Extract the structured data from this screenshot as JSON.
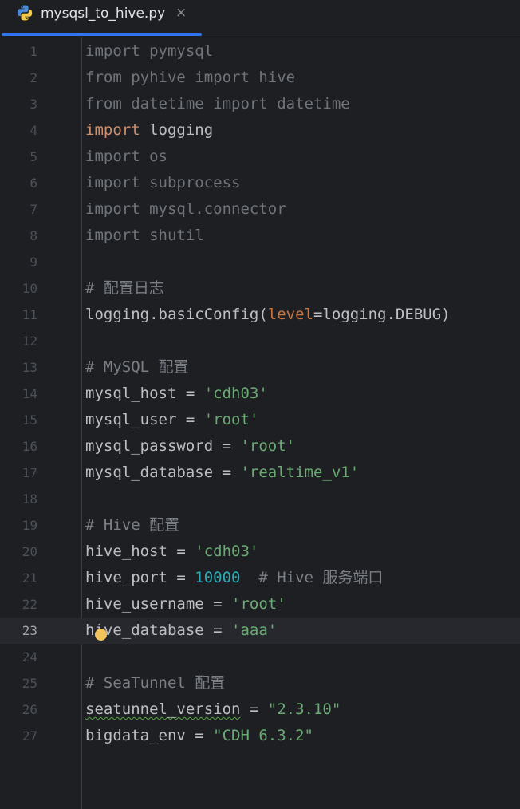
{
  "tab": {
    "title": "mysqsl_to_hive.py",
    "close_glyph": "×",
    "icon": "python-icon"
  },
  "editor": {
    "current_line": 23,
    "intention_icon": "lightbulb-icon",
    "lines": [
      {
        "n": "1",
        "tokens": [
          {
            "t": "import pymysql",
            "c": "dim"
          }
        ]
      },
      {
        "n": "2",
        "tokens": [
          {
            "t": "from pyhive import hive",
            "c": "dim"
          }
        ]
      },
      {
        "n": "3",
        "tokens": [
          {
            "t": "from datetime import datetime",
            "c": "dim"
          }
        ]
      },
      {
        "n": "4",
        "tokens": [
          {
            "t": "import",
            "c": "kw"
          },
          {
            "t": " logging",
            "c": "plain"
          }
        ]
      },
      {
        "n": "5",
        "tokens": [
          {
            "t": "import os",
            "c": "dim"
          }
        ]
      },
      {
        "n": "6",
        "tokens": [
          {
            "t": "import subprocess",
            "c": "dim"
          }
        ]
      },
      {
        "n": "7",
        "tokens": [
          {
            "t": "import mysql.connector",
            "c": "dim"
          }
        ]
      },
      {
        "n": "8",
        "tokens": [
          {
            "t": "import shutil",
            "c": "dim"
          }
        ]
      },
      {
        "n": "9",
        "tokens": []
      },
      {
        "n": "10",
        "tokens": [
          {
            "t": "# 配置日志",
            "c": "com"
          }
        ]
      },
      {
        "n": "11",
        "tokens": [
          {
            "t": "logging.basicConfig(",
            "c": "plain"
          },
          {
            "t": "level",
            "c": "param"
          },
          {
            "t": "=logging.DEBUG)",
            "c": "plain"
          }
        ]
      },
      {
        "n": "12",
        "tokens": []
      },
      {
        "n": "13",
        "tokens": [
          {
            "t": "# MySQL 配置",
            "c": "com"
          }
        ]
      },
      {
        "n": "14",
        "tokens": [
          {
            "t": "mysql_host = ",
            "c": "plain"
          },
          {
            "t": "'cdh03'",
            "c": "str"
          }
        ]
      },
      {
        "n": "15",
        "tokens": [
          {
            "t": "mysql_user = ",
            "c": "plain"
          },
          {
            "t": "'root'",
            "c": "str"
          }
        ]
      },
      {
        "n": "16",
        "tokens": [
          {
            "t": "mysql_password = ",
            "c": "plain"
          },
          {
            "t": "'root'",
            "c": "str"
          }
        ]
      },
      {
        "n": "17",
        "tokens": [
          {
            "t": "mysql_database = ",
            "c": "plain"
          },
          {
            "t": "'realtime_v1'",
            "c": "str"
          }
        ]
      },
      {
        "n": "18",
        "tokens": []
      },
      {
        "n": "19",
        "tokens": [
          {
            "t": "# Hive 配置",
            "c": "com"
          }
        ]
      },
      {
        "n": "20",
        "tokens": [
          {
            "t": "hive_host = ",
            "c": "plain"
          },
          {
            "t": "'cdh03'",
            "c": "str"
          }
        ]
      },
      {
        "n": "21",
        "tokens": [
          {
            "t": "hive_port = ",
            "c": "plain"
          },
          {
            "t": "10000",
            "c": "num"
          },
          {
            "t": "  # Hive 服务端口",
            "c": "com"
          }
        ]
      },
      {
        "n": "22",
        "tokens": [
          {
            "t": "hive_username = ",
            "c": "plain"
          },
          {
            "t": "'root'",
            "c": "str"
          }
        ]
      },
      {
        "n": "23",
        "tokens": [
          {
            "t": "hive_database = ",
            "c": "plain"
          },
          {
            "t": "'aaa'",
            "c": "str"
          }
        ]
      },
      {
        "n": "24",
        "tokens": []
      },
      {
        "n": "25",
        "tokens": [
          {
            "t": "# SeaTunnel 配置",
            "c": "com"
          }
        ]
      },
      {
        "n": "26",
        "tokens": [
          {
            "t": "seatunnel_version",
            "c": "squiggle"
          },
          {
            "t": " = ",
            "c": "plain"
          },
          {
            "t": "\"2.3.10\"",
            "c": "str"
          }
        ]
      },
      {
        "n": "27",
        "tokens": [
          {
            "t": "bigdata_env = ",
            "c": "plain"
          },
          {
            "t": "\"CDH 6.3.2\"",
            "c": "str"
          }
        ]
      }
    ]
  },
  "colors": {
    "background": "#1e1f22",
    "current_line": "#26282e",
    "tab_underline": "#3574f0",
    "keyword": "#cf8e6d",
    "string": "#6aab73",
    "number": "#2aacb8",
    "comment": "#7a7e85",
    "parameter": "#c77540",
    "unused_import": "#6f737a"
  }
}
